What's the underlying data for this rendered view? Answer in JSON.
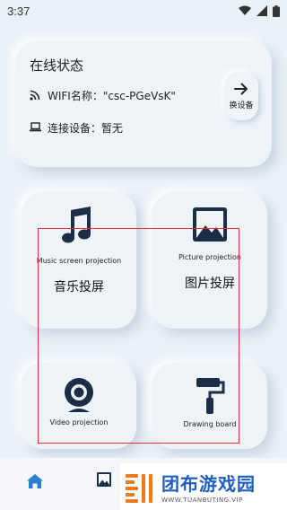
{
  "status_bar": {
    "time": "3:37"
  },
  "online_status": {
    "title": "在线状态",
    "wifi_label": "WIFI名称：",
    "wifi_value": "\"csc-PGeVsK\"",
    "device_label": "连接设备：",
    "device_value": "暂无",
    "switch_device": "换设备"
  },
  "tiles": {
    "music": {
      "en": "Music screen projection",
      "zh": "音乐投屏"
    },
    "picture": {
      "en": "Picture projection",
      "zh": "图片投屏"
    },
    "video": {
      "en": "Video projection"
    },
    "drawing": {
      "en": "Drawing board"
    }
  },
  "watermark": {
    "title": "团布游戏园",
    "subtitle": "WWW.TUANBUTING.VIP"
  },
  "colors": {
    "background": "#e9f0f6",
    "accent": "#2f7fd0",
    "highlight": "#e03030",
    "brand_orange": "#f07a1a",
    "brand_blue": "#1f5fbf"
  }
}
